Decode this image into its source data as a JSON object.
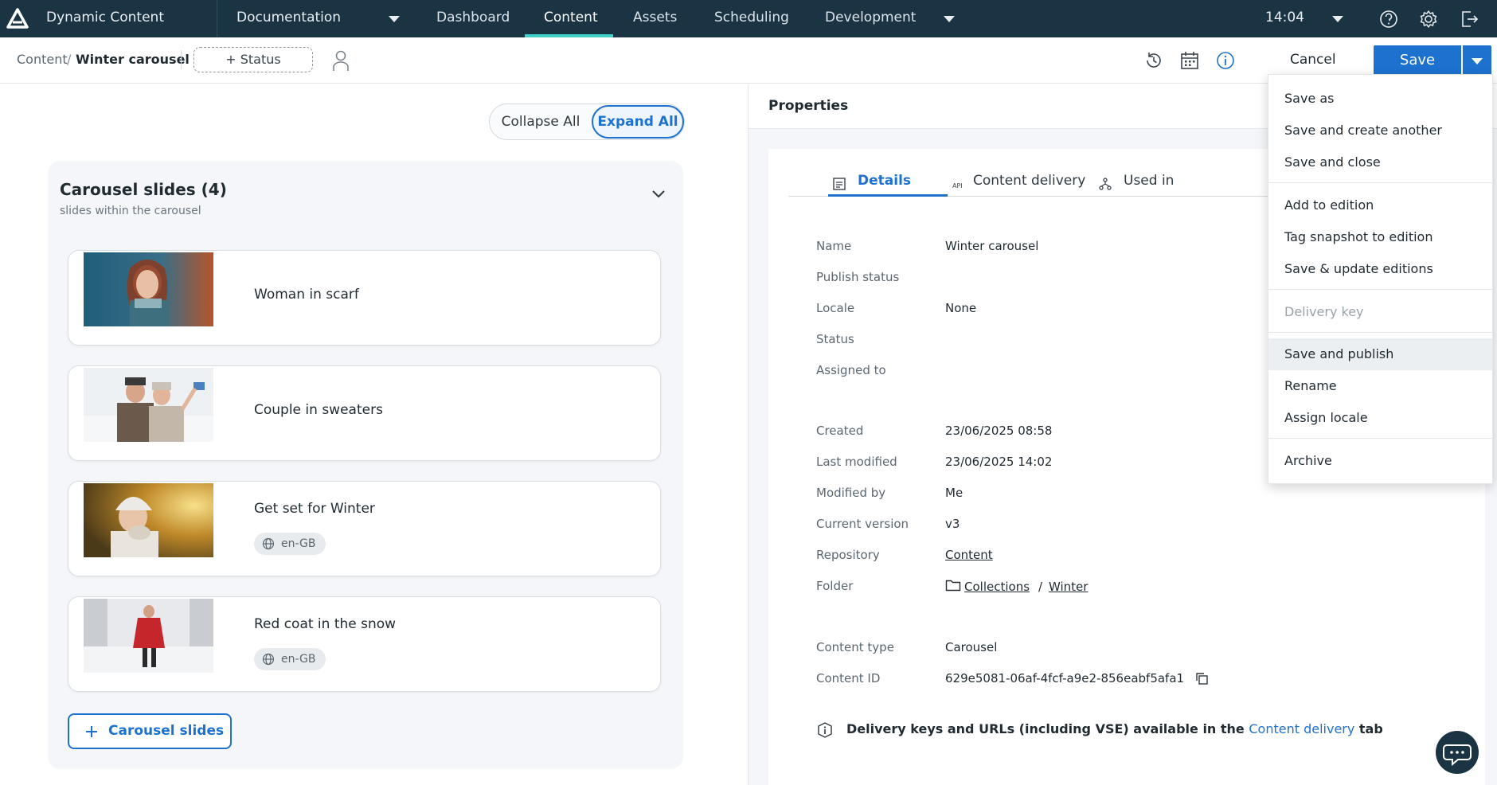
{
  "topbar": {
    "app_name": "Dynamic Content",
    "hub_selector": "Documentation",
    "nav": [
      "Dashboard",
      "Content",
      "Assets",
      "Scheduling",
      "Development"
    ],
    "active_nav": "Content",
    "clock": "14:04"
  },
  "breadcrumb": {
    "root": "Content",
    "separator": "/",
    "current": "Winter carousel"
  },
  "toolbar": {
    "status_button": "+ Status",
    "cancel_label": "Cancel",
    "save_label": "Save"
  },
  "left": {
    "collapse_all": "Collapse All",
    "expand_all": "Expand All",
    "panel_title": "Carousel slides (4)",
    "panel_subtitle": "slides within the carousel",
    "slides": [
      {
        "title": "Woman in scarf",
        "locale": ""
      },
      {
        "title": "Couple in sweaters",
        "locale": ""
      },
      {
        "title": "Get set for Winter",
        "locale": "en-GB"
      },
      {
        "title": "Red coat in the snow",
        "locale": "en-GB"
      }
    ],
    "add_button": "Carousel slides"
  },
  "properties": {
    "title": "Properties",
    "tabs": [
      "Details",
      "Content delivery",
      "Used in"
    ],
    "active_tab": "Details",
    "fields": {
      "name_label": "Name",
      "name_value": "Winter carousel",
      "publish_status_label": "Publish status",
      "locale_label": "Locale",
      "locale_value": "None",
      "status_label": "Status",
      "assigned_label": "Assigned to",
      "created_label": "Created",
      "created_value": "23/06/2025 08:58",
      "modified_label": "Last modified",
      "modified_value": "23/06/2025 14:02",
      "modified_by_label": "Modified by",
      "modified_by_value": "Me",
      "version_label": "Current version",
      "version_value": "v3",
      "repository_label": "Repository",
      "repository_value": "Content",
      "folder_label": "Folder",
      "folder_path_1": "Collections",
      "folder_sep": "/",
      "folder_path_2": "Winter",
      "content_type_label": "Content type",
      "content_type_value": "Carousel",
      "content_id_label": "Content ID",
      "content_id_value": "629e5081-06af-4fcf-a9e2-856eabf5afa1"
    },
    "info": {
      "text_before": "Delivery keys and URLs (including VSE) available in the",
      "link": "Content delivery",
      "text_after": "tab"
    }
  },
  "save_menu": {
    "items": [
      "Save as",
      "Save and create another",
      "Save and close",
      "Add to edition",
      "Tag snapshot to edition",
      "Save & update editions",
      "Delivery key",
      "Save and publish",
      "Rename",
      "Assign locale",
      "Archive"
    ],
    "disabled_item": "Delivery key",
    "hovered_item": "Save and publish"
  },
  "colors": {
    "topbar_bg": "#1b3444",
    "accent_blue": "#1d72cf",
    "active_tab_bar": "#3fd0c9"
  },
  "icons": [
    "logo-icon",
    "chevron-down-icon",
    "help-icon",
    "settings-icon",
    "logout-icon",
    "person-icon",
    "history-icon",
    "calendar-icon",
    "info-icon",
    "globe-icon",
    "plus-icon",
    "details-icon",
    "api-icon",
    "hierarchy-icon",
    "copy-icon",
    "folder-icon",
    "chat-icon"
  ]
}
